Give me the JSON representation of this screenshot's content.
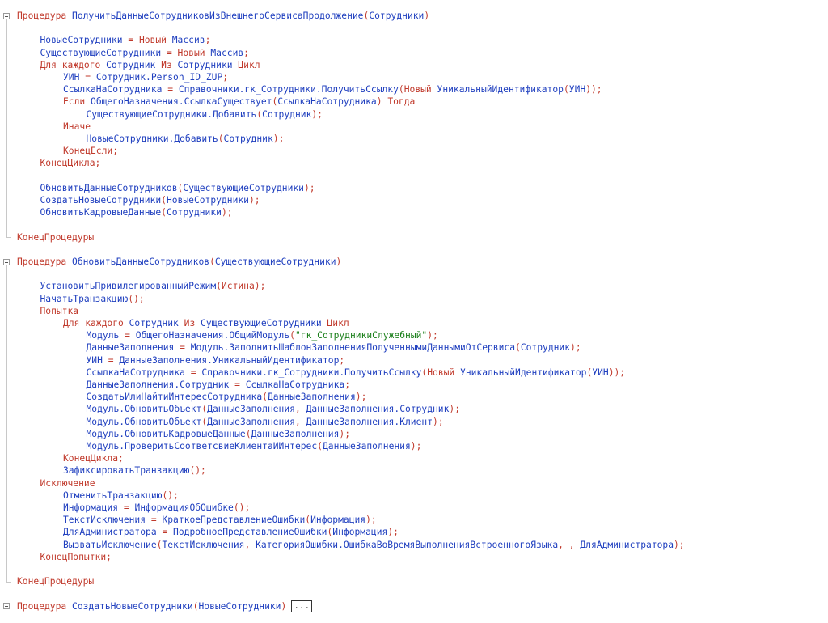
{
  "editor": {
    "lines": [
      {
        "indent": 0,
        "tokens": [
          [
            "kw",
            "Процедура "
          ],
          [
            "id",
            "ПолучитьДанныеСотрудниковИзВнешнегоСервисаПродолжение"
          ],
          [
            "pu",
            "("
          ],
          [
            "id",
            "Сотрудники"
          ],
          [
            "pu",
            ")"
          ]
        ]
      },
      {
        "indent": 0,
        "tokens": []
      },
      {
        "indent": 1,
        "tokens": [
          [
            "id",
            "НовыеСотрудники "
          ],
          [
            "op",
            "= "
          ],
          [
            "kw",
            "Новый "
          ],
          [
            "id",
            "Массив"
          ],
          [
            "pu",
            ";"
          ]
        ]
      },
      {
        "indent": 1,
        "tokens": [
          [
            "id",
            "СуществующиеСотрудники "
          ],
          [
            "op",
            "= "
          ],
          [
            "kw",
            "Новый "
          ],
          [
            "id",
            "Массив"
          ],
          [
            "pu",
            ";"
          ]
        ]
      },
      {
        "indent": 1,
        "tokens": [
          [
            "kw",
            "Для каждого "
          ],
          [
            "id",
            "Сотрудник "
          ],
          [
            "kw",
            "Из "
          ],
          [
            "id",
            "Сотрудники "
          ],
          [
            "kw",
            "Цикл"
          ]
        ]
      },
      {
        "indent": 2,
        "tokens": [
          [
            "id",
            "УИН "
          ],
          [
            "op",
            "= "
          ],
          [
            "id",
            "Сотрудник.Person_ID_ZUP"
          ],
          [
            "pu",
            ";"
          ]
        ]
      },
      {
        "indent": 2,
        "tokens": [
          [
            "id",
            "СсылкаНаСотрудника "
          ],
          [
            "op",
            "= "
          ],
          [
            "id",
            "Справочники.гк_Сотрудники.ПолучитьСсылку"
          ],
          [
            "pu",
            "("
          ],
          [
            "kw",
            "Новый "
          ],
          [
            "id",
            "УникальныйИдентификатор"
          ],
          [
            "pu",
            "("
          ],
          [
            "id",
            "УИН"
          ],
          [
            "pu",
            "));"
          ]
        ]
      },
      {
        "indent": 2,
        "tokens": [
          [
            "kw",
            "Если "
          ],
          [
            "id",
            "ОбщегоНазначения.СсылкаСуществует"
          ],
          [
            "pu",
            "("
          ],
          [
            "id",
            "СсылкаНаСотрудника"
          ],
          [
            "pu",
            ") "
          ],
          [
            "kw",
            "Тогда"
          ]
        ]
      },
      {
        "indent": 3,
        "tokens": [
          [
            "id",
            "СуществующиеСотрудники.Добавить"
          ],
          [
            "pu",
            "("
          ],
          [
            "id",
            "Сотрудник"
          ],
          [
            "pu",
            ");"
          ]
        ]
      },
      {
        "indent": 2,
        "tokens": [
          [
            "kw",
            "Иначе"
          ]
        ]
      },
      {
        "indent": 3,
        "tokens": [
          [
            "id",
            "НовыеСотрудники.Добавить"
          ],
          [
            "pu",
            "("
          ],
          [
            "id",
            "Сотрудник"
          ],
          [
            "pu",
            ");"
          ]
        ]
      },
      {
        "indent": 2,
        "tokens": [
          [
            "kw",
            "КонецЕсли"
          ],
          [
            "pu",
            ";"
          ]
        ]
      },
      {
        "indent": 1,
        "tokens": [
          [
            "kw",
            "КонецЦикла"
          ],
          [
            "pu",
            ";"
          ]
        ]
      },
      {
        "indent": 0,
        "tokens": []
      },
      {
        "indent": 1,
        "tokens": [
          [
            "id",
            "ОбновитьДанныеСотрудников"
          ],
          [
            "pu",
            "("
          ],
          [
            "id",
            "СуществующиеСотрудники"
          ],
          [
            "pu",
            ");"
          ]
        ]
      },
      {
        "indent": 1,
        "tokens": [
          [
            "id",
            "СоздатьНовыеСотрудники"
          ],
          [
            "pu",
            "("
          ],
          [
            "id",
            "НовыеСотрудники"
          ],
          [
            "pu",
            ");"
          ]
        ]
      },
      {
        "indent": 1,
        "tokens": [
          [
            "id",
            "ОбновитьКадровыеДанные"
          ],
          [
            "pu",
            "("
          ],
          [
            "id",
            "Сотрудники"
          ],
          [
            "pu",
            ");"
          ]
        ]
      },
      {
        "indent": 0,
        "tokens": []
      },
      {
        "indent": 0,
        "tokens": [
          [
            "kw",
            "КонецПроцедуры"
          ]
        ]
      },
      {
        "indent": 0,
        "tokens": []
      },
      {
        "indent": 0,
        "tokens": [
          [
            "kw",
            "Процедура "
          ],
          [
            "id",
            "ОбновитьДанныеСотрудников"
          ],
          [
            "pu",
            "("
          ],
          [
            "id",
            "СуществующиеСотрудники"
          ],
          [
            "pu",
            ")"
          ]
        ]
      },
      {
        "indent": 0,
        "tokens": []
      },
      {
        "indent": 1,
        "tokens": [
          [
            "id",
            "УстановитьПривилегированныйРежим"
          ],
          [
            "pu",
            "("
          ],
          [
            "kw",
            "Истина"
          ],
          [
            "pu",
            ");"
          ]
        ]
      },
      {
        "indent": 1,
        "tokens": [
          [
            "id",
            "НачатьТранзакцию"
          ],
          [
            "pu",
            "();"
          ]
        ]
      },
      {
        "indent": 1,
        "tokens": [
          [
            "kw",
            "Попытка"
          ]
        ]
      },
      {
        "indent": 2,
        "tokens": [
          [
            "kw",
            "Для каждого "
          ],
          [
            "id",
            "Сотрудник "
          ],
          [
            "kw",
            "Из "
          ],
          [
            "id",
            "СуществующиеСотрудники "
          ],
          [
            "kw",
            "Цикл"
          ]
        ]
      },
      {
        "indent": 3,
        "tokens": [
          [
            "id",
            "Модуль "
          ],
          [
            "op",
            "= "
          ],
          [
            "id",
            "ОбщегоНазначения.ОбщийМодуль"
          ],
          [
            "pu",
            "("
          ],
          [
            "st",
            "\"гк_СотрудникиСлужебный\""
          ],
          [
            "pu",
            ");"
          ]
        ]
      },
      {
        "indent": 3,
        "tokens": [
          [
            "id",
            "ДанныеЗаполнения "
          ],
          [
            "op",
            "= "
          ],
          [
            "id",
            "Модуль.ЗаполнитьШаблонЗаполненияПолученнымиДаннымиОтСервиса"
          ],
          [
            "pu",
            "("
          ],
          [
            "id",
            "Сотрудник"
          ],
          [
            "pu",
            ");"
          ]
        ]
      },
      {
        "indent": 3,
        "tokens": [
          [
            "id",
            "УИН "
          ],
          [
            "op",
            "= "
          ],
          [
            "id",
            "ДанныеЗаполнения.УникальныйИдентификатор"
          ],
          [
            "pu",
            ";"
          ]
        ]
      },
      {
        "indent": 3,
        "tokens": [
          [
            "id",
            "СсылкаНаСотрудника "
          ],
          [
            "op",
            "= "
          ],
          [
            "id",
            "Справочники.гк_Сотрудники.ПолучитьСсылку"
          ],
          [
            "pu",
            "("
          ],
          [
            "kw",
            "Новый "
          ],
          [
            "id",
            "УникальныйИдентификатор"
          ],
          [
            "pu",
            "("
          ],
          [
            "id",
            "УИН"
          ],
          [
            "pu",
            "));"
          ]
        ]
      },
      {
        "indent": 3,
        "tokens": [
          [
            "id",
            "ДанныеЗаполнения.Сотрудник "
          ],
          [
            "op",
            "= "
          ],
          [
            "id",
            "СсылкаНаСотрудника"
          ],
          [
            "pu",
            ";"
          ]
        ]
      },
      {
        "indent": 3,
        "tokens": [
          [
            "id",
            "СоздатьИлиНайтиИнтересСотрудника"
          ],
          [
            "pu",
            "("
          ],
          [
            "id",
            "ДанныеЗаполнения"
          ],
          [
            "pu",
            ");"
          ]
        ]
      },
      {
        "indent": 3,
        "tokens": [
          [
            "id",
            "Модуль.ОбновитьОбъект"
          ],
          [
            "pu",
            "("
          ],
          [
            "id",
            "ДанныеЗаполнения"
          ],
          [
            "pu",
            ", "
          ],
          [
            "id",
            "ДанныеЗаполнения.Сотрудник"
          ],
          [
            "pu",
            ");"
          ]
        ]
      },
      {
        "indent": 3,
        "tokens": [
          [
            "id",
            "Модуль.ОбновитьОбъект"
          ],
          [
            "pu",
            "("
          ],
          [
            "id",
            "ДанныеЗаполнения"
          ],
          [
            "pu",
            ", "
          ],
          [
            "id",
            "ДанныеЗаполнения.Клиент"
          ],
          [
            "pu",
            ");"
          ]
        ]
      },
      {
        "indent": 3,
        "tokens": [
          [
            "id",
            "Модуль.ОбновитьКадровыеДанные"
          ],
          [
            "pu",
            "("
          ],
          [
            "id",
            "ДанныеЗаполнения"
          ],
          [
            "pu",
            ");"
          ]
        ]
      },
      {
        "indent": 3,
        "tokens": [
          [
            "id",
            "Модуль.ПроверитьСоответсвиеКлиентаИИнтерес"
          ],
          [
            "pu",
            "("
          ],
          [
            "id",
            "ДанныеЗаполнения"
          ],
          [
            "pu",
            ");"
          ]
        ]
      },
      {
        "indent": 2,
        "tokens": [
          [
            "kw",
            "КонецЦикла"
          ],
          [
            "pu",
            ";"
          ]
        ]
      },
      {
        "indent": 2,
        "tokens": [
          [
            "id",
            "ЗафиксироватьТранзакцию"
          ],
          [
            "pu",
            "();"
          ]
        ]
      },
      {
        "indent": 1,
        "tokens": [
          [
            "kw",
            "Исключение"
          ]
        ]
      },
      {
        "indent": 2,
        "tokens": [
          [
            "id",
            "ОтменитьТранзакцию"
          ],
          [
            "pu",
            "();"
          ]
        ]
      },
      {
        "indent": 2,
        "tokens": [
          [
            "id",
            "Информация "
          ],
          [
            "op",
            "= "
          ],
          [
            "id",
            "ИнформацияОбОшибке"
          ],
          [
            "pu",
            "();"
          ]
        ]
      },
      {
        "indent": 2,
        "tokens": [
          [
            "id",
            "ТекстИсключения "
          ],
          [
            "op",
            "= "
          ],
          [
            "id",
            "КраткоеПредставлениеОшибки"
          ],
          [
            "pu",
            "("
          ],
          [
            "id",
            "Информация"
          ],
          [
            "pu",
            ");"
          ]
        ]
      },
      {
        "indent": 2,
        "tokens": [
          [
            "id",
            "ДляАдминистратора "
          ],
          [
            "op",
            "= "
          ],
          [
            "id",
            "ПодробноеПредставлениеОшибки"
          ],
          [
            "pu",
            "("
          ],
          [
            "id",
            "Информация"
          ],
          [
            "pu",
            ");"
          ]
        ]
      },
      {
        "indent": 2,
        "tokens": [
          [
            "id",
            "ВызватьИсключение"
          ],
          [
            "pu",
            "("
          ],
          [
            "id",
            "ТекстИсключения"
          ],
          [
            "pu",
            ", "
          ],
          [
            "id",
            "КатегорияОшибки.ОшибкаВоВремяВыполненияВстроенногоЯзыка"
          ],
          [
            "pu",
            ", , "
          ],
          [
            "id",
            "ДляАдминистратора"
          ],
          [
            "pu",
            ");"
          ]
        ]
      },
      {
        "indent": 1,
        "tokens": [
          [
            "kw",
            "КонецПопытки"
          ],
          [
            "pu",
            ";"
          ]
        ]
      },
      {
        "indent": 0,
        "tokens": []
      },
      {
        "indent": 0,
        "tokens": [
          [
            "kw",
            "КонецПроцедуры"
          ]
        ]
      },
      {
        "indent": 0,
        "tokens": []
      },
      {
        "indent": 0,
        "tokens": [
          [
            "kw",
            "Процедура "
          ],
          [
            "id",
            "СоздатьНовыеСотрудники"
          ],
          [
            "pu",
            "("
          ],
          [
            "id",
            "НовыеСотрудники"
          ],
          [
            "pu",
            ")"
          ]
        ],
        "collapsed": true
      }
    ],
    "collapsed_marker": "..."
  }
}
